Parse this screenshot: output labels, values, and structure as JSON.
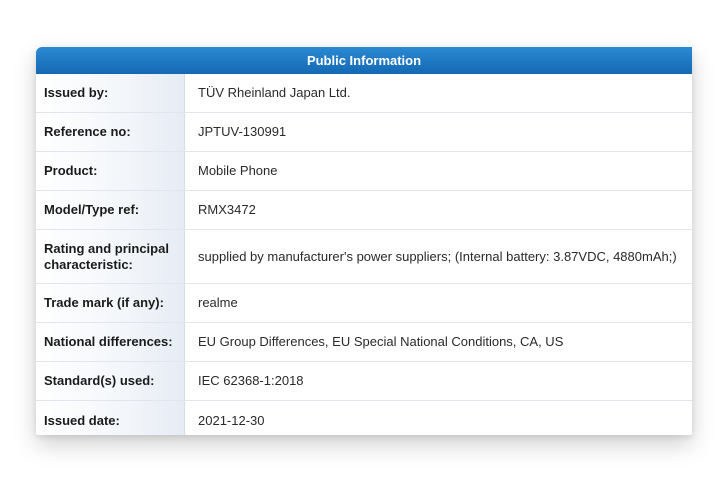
{
  "header": {
    "title": "Public Information"
  },
  "rows": [
    {
      "label": "Issued by:",
      "value": "TÜV Rheinland Japan Ltd."
    },
    {
      "label": "Reference no:",
      "value": "JPTUV-130991"
    },
    {
      "label": "Product:",
      "value": "Mobile Phone"
    },
    {
      "label": "Model/Type ref:",
      "value": "RMX3472"
    },
    {
      "label": "Rating and principal characteristic:",
      "value": "supplied by manufacturer's power suppliers; (Internal battery: 3.87VDC, 4880mAh;)"
    },
    {
      "label": "Trade mark (if any):",
      "value": "realme"
    },
    {
      "label": "National differences:",
      "value": "EU Group Differences, EU Special National Conditions, CA, US"
    },
    {
      "label": "Standard(s) used:",
      "value": "IEC 62368-1:2018"
    },
    {
      "label": "Issued date:",
      "value": "2021-12-30"
    }
  ]
}
